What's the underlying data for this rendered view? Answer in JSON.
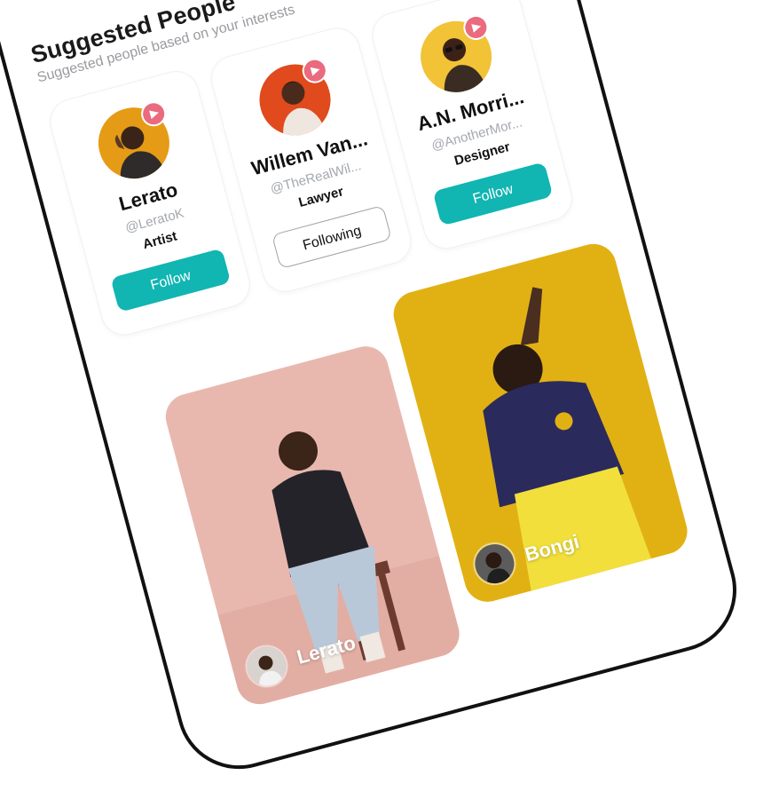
{
  "section": {
    "title": "Suggested People",
    "subtitle": "Suggested people based on your interests"
  },
  "suggested_people": [
    {
      "name": "Lerato",
      "handle": "@LeratoK",
      "role": "Artist",
      "button": "Follow",
      "state": "follow",
      "avatar_bg": "#e69b16"
    },
    {
      "name": "Willem Van...",
      "handle": "@TheRealWil...",
      "role": "Lawyer",
      "button": "Following",
      "state": "following",
      "avatar_bg": "#e04a1c"
    },
    {
      "name": "A.N. Morri...",
      "handle": "@AnotherMor...",
      "role": "Designer",
      "button": "Follow",
      "state": "follow",
      "avatar_bg": "#f2c237"
    }
  ],
  "posts": [
    {
      "author": "Lerato",
      "bg": "#e8b8af"
    },
    {
      "author": "Bongi",
      "bg": "#e1b114"
    }
  ],
  "colors": {
    "accent": "#11b5b2",
    "play_badge": "#ea6a7e"
  },
  "icons": {
    "badge": "play-icon"
  }
}
